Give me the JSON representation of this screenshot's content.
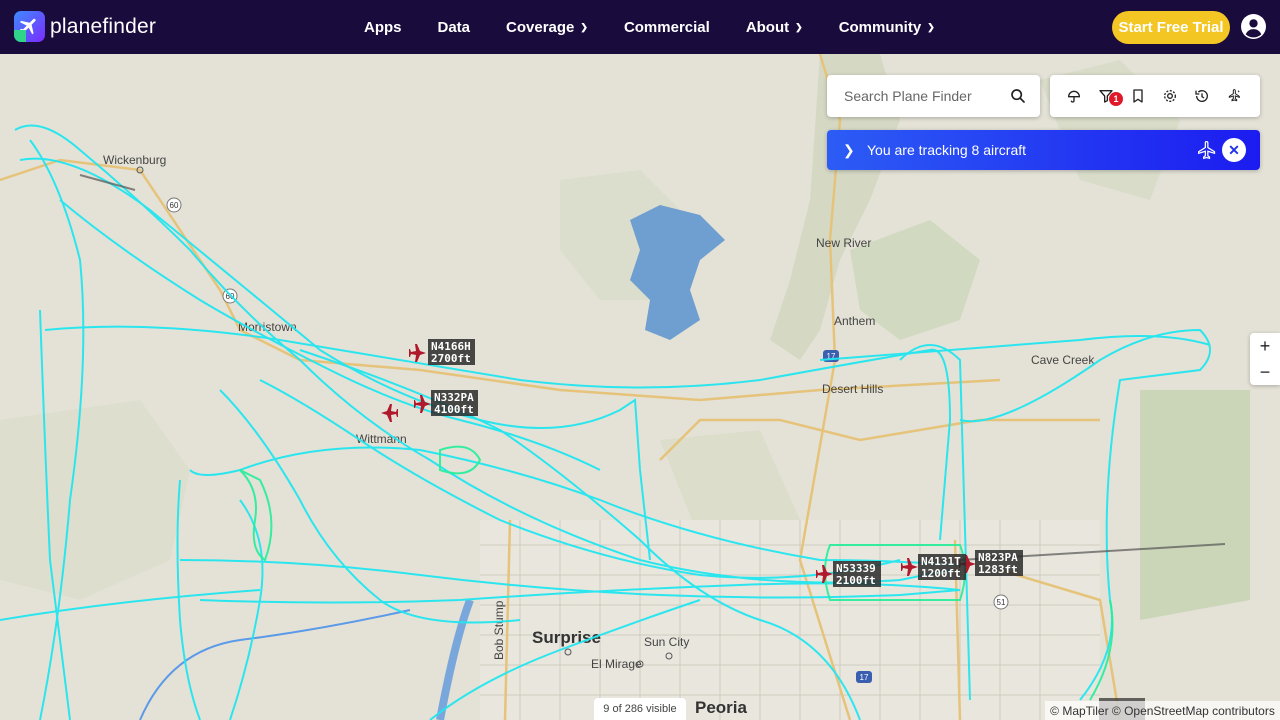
{
  "brand": {
    "name": "planefinder"
  },
  "nav": {
    "items": [
      {
        "label": "Apps"
      },
      {
        "label": "Data"
      },
      {
        "label": "Coverage"
      },
      {
        "label": "Commercial"
      },
      {
        "label": "About"
      },
      {
        "label": "Community"
      }
    ],
    "trial_label": "Start Free Trial"
  },
  "search": {
    "placeholder": "Search Plane Finder"
  },
  "toolbar": {
    "filter_badge": "1"
  },
  "tracking": {
    "text": "You are tracking 8 aircraft"
  },
  "zoom": {
    "in_label": "+",
    "out_label": "−"
  },
  "status": {
    "visible_count": "9 of 286 visible"
  },
  "attribution": "© MapTiler © OpenStreetMap contributors",
  "map_labels": {
    "places": [
      "Wickenburg",
      "New River",
      "Anthem",
      "Desert Hills",
      "Cave Creek",
      "Morristown",
      "Wittmann",
      "Surprise",
      "Sun City",
      "El Mirage",
      "Peoria"
    ],
    "roads": [
      "60",
      "60",
      "17",
      "17",
      "51"
    ],
    "street": "Bob Stump"
  },
  "aircraft": [
    {
      "callsign": "N4166H",
      "altitude": "2700ft"
    },
    {
      "callsign": "N332PA",
      "altitude": "4100ft"
    },
    {
      "callsign": "N53339",
      "altitude": "2100ft"
    },
    {
      "callsign": "N4131T",
      "altitude": "1200ft"
    },
    {
      "callsign": "N823PA",
      "altitude": "1283ft"
    }
  ],
  "colors": {
    "header_bg": "#1a0b3d",
    "trial_button": "#f3c624",
    "track": "#22e6f0",
    "track_low": "#22ee99",
    "aircraft": "#b0182c",
    "tracking_bar": "#2233ee"
  }
}
